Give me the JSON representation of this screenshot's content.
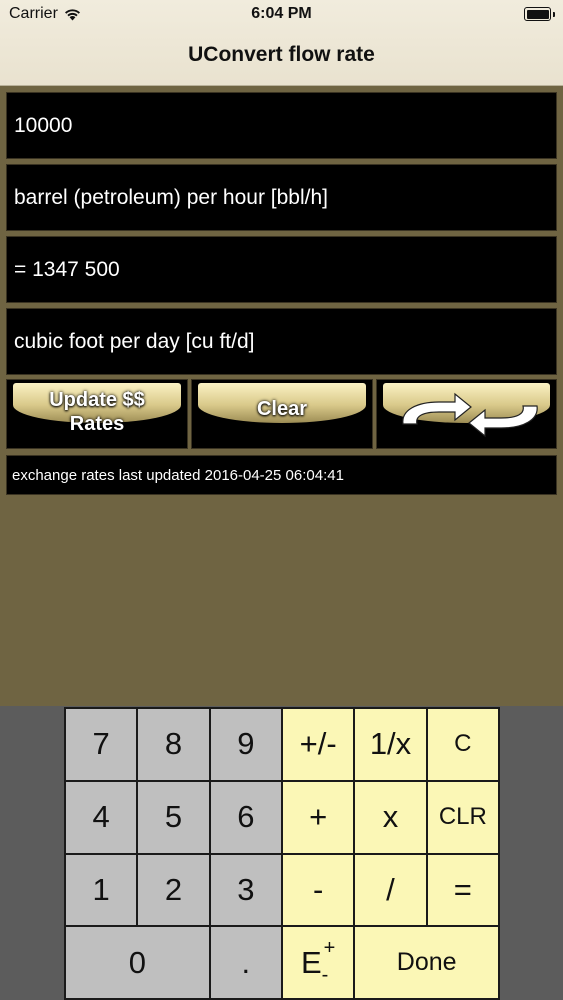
{
  "status": {
    "carrier": "Carrier",
    "time": "6:04 PM"
  },
  "nav": {
    "title": "UConvert flow rate"
  },
  "fields": {
    "input_value": "10000",
    "from_unit": "barrel (petroleum) per hour [bbl/h]",
    "result": "= 1347 500",
    "to_unit": "cubic foot per day [cu ft/d]"
  },
  "buttons": {
    "update_line1": "Update $$",
    "update_line2": "Rates",
    "clear": "Clear",
    "swap_icon": "swap-arrows-icon"
  },
  "note": "exchange rates last updated 2016-04-25 06:04:41",
  "keypad": {
    "k7": "7",
    "k8": "8",
    "k9": "9",
    "plus_minus": "+/-",
    "reciprocal": "1/x",
    "c": "C",
    "k4": "4",
    "k5": "5",
    "k6": "6",
    "plus": "+",
    "times": "x",
    "clr": "CLR",
    "k1": "1",
    "k2": "2",
    "k3": "3",
    "minus": "-",
    "divide": "/",
    "equals": "=",
    "k0": "0",
    "dot": ".",
    "exp_e": "E",
    "exp_plus": "+",
    "exp_minus": "-",
    "done": "Done"
  },
  "colors": {
    "background": "#6f6442",
    "number_key": "#bfbfbf",
    "operator_key": "#fbf7b6",
    "field_bg": "#000000"
  }
}
